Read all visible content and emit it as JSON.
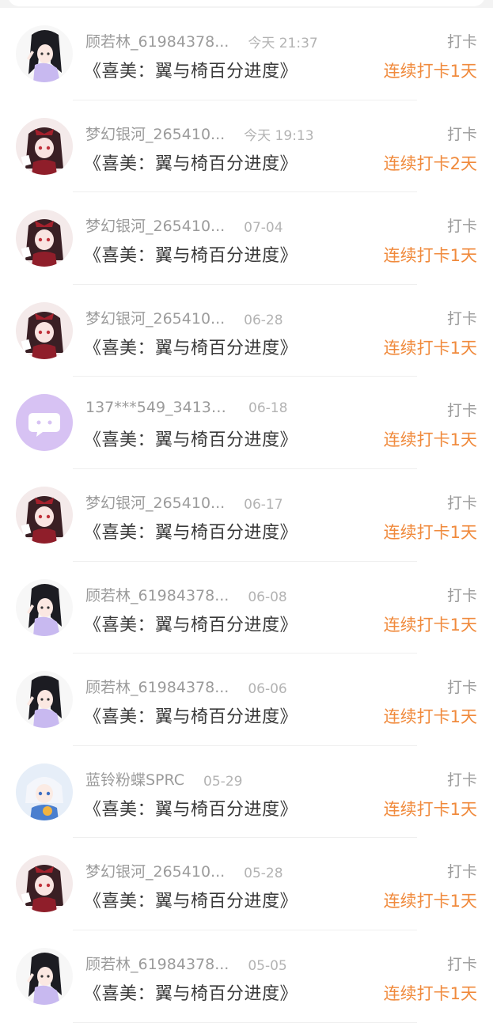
{
  "entries": [
    {
      "user": "顾若林_61984378...",
      "time": "今天 21:37",
      "title": "《喜美：翼与椅百分进度》",
      "action": "打卡",
      "streak": "连续打卡1天",
      "avatar": "dark-hair-girl"
    },
    {
      "user": "梦幻银河_265410...",
      "time": "今天 19:13",
      "title": "《喜美：翼与椅百分进度》",
      "action": "打卡",
      "streak": "连续打卡2天",
      "avatar": "ribbon-girl"
    },
    {
      "user": "梦幻银河_265410...",
      "time": "07-04",
      "title": "《喜美：翼与椅百分进度》",
      "action": "打卡",
      "streak": "连续打卡1天",
      "avatar": "ribbon-girl"
    },
    {
      "user": "梦幻银河_265410...",
      "time": "06-28",
      "title": "《喜美：翼与椅百分进度》",
      "action": "打卡",
      "streak": "连续打卡1天",
      "avatar": "ribbon-girl"
    },
    {
      "user": "137***549_34138...",
      "time": "06-18",
      "title": "《喜美：翼与椅百分进度》",
      "action": "打卡",
      "streak": "连续打卡1天",
      "avatar": "default-bubble"
    },
    {
      "user": "梦幻银河_265410...",
      "time": "06-17",
      "title": "《喜美：翼与椅百分进度》",
      "action": "打卡",
      "streak": "连续打卡1天",
      "avatar": "ribbon-girl"
    },
    {
      "user": "顾若林_61984378...",
      "time": "06-08",
      "title": "《喜美：翼与椅百分进度》",
      "action": "打卡",
      "streak": "连续打卡1天",
      "avatar": "dark-hair-girl"
    },
    {
      "user": "顾若林_61984378...",
      "time": "06-06",
      "title": "《喜美：翼与椅百分进度》",
      "action": "打卡",
      "streak": "连续打卡1天",
      "avatar": "dark-hair-girl"
    },
    {
      "user": "蓝铃粉蝶SPRC",
      "time": "05-29",
      "title": "《喜美：翼与椅百分进度》",
      "action": "打卡",
      "streak": "连续打卡1天",
      "avatar": "white-hair-girl"
    },
    {
      "user": "梦幻银河_265410...",
      "time": "05-28",
      "title": "《喜美：翼与椅百分进度》",
      "action": "打卡",
      "streak": "连续打卡1天",
      "avatar": "ribbon-girl"
    },
    {
      "user": "顾若林_61984378...",
      "time": "05-05",
      "title": "《喜美：翼与椅百分进度》",
      "action": "打卡",
      "streak": "连续打卡1天",
      "avatar": "dark-hair-girl"
    }
  ],
  "colors": {
    "accent": "#f08a3c",
    "muted_text": "#9b9b9b",
    "title_text": "#3a3a3a",
    "default_avatar_bg": "#d7c2f3"
  }
}
